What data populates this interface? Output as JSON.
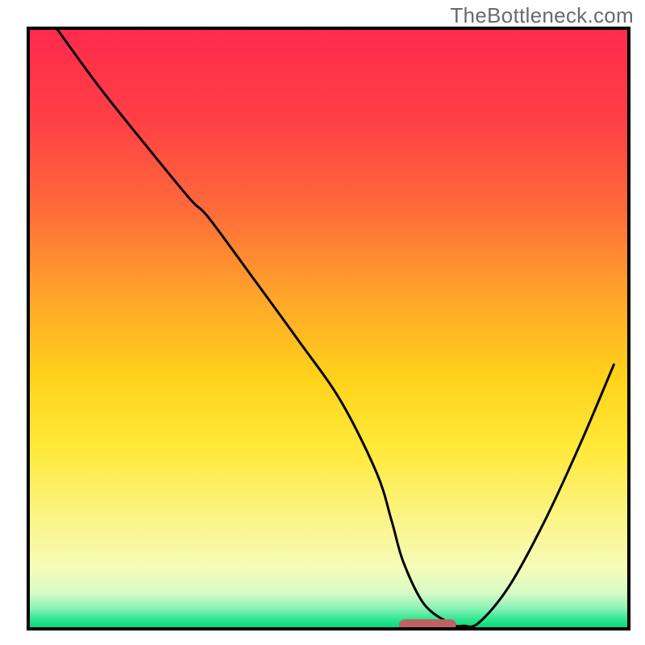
{
  "watermark": "TheBottleneck.com",
  "chart_data": {
    "type": "line",
    "title": "",
    "xlabel": "",
    "ylabel": "",
    "xlim": [
      0,
      100
    ],
    "ylim": [
      0,
      100
    ],
    "axes_visible": false,
    "grid": false,
    "background_gradient_stops": [
      {
        "offset": 0.0,
        "color": "#ff2a4d"
      },
      {
        "offset": 0.15,
        "color": "#ff3f46"
      },
      {
        "offset": 0.3,
        "color": "#ff6a3a"
      },
      {
        "offset": 0.45,
        "color": "#ffa629"
      },
      {
        "offset": 0.58,
        "color": "#ffd21a"
      },
      {
        "offset": 0.7,
        "color": "#ffe93a"
      },
      {
        "offset": 0.82,
        "color": "#fbf58a"
      },
      {
        "offset": 0.9,
        "color": "#f6fbb8"
      },
      {
        "offset": 0.94,
        "color": "#d7fbc5"
      },
      {
        "offset": 0.965,
        "color": "#8cf3b9"
      },
      {
        "offset": 0.985,
        "color": "#2be68d"
      },
      {
        "offset": 1.0,
        "color": "#06d574"
      }
    ],
    "series": [
      {
        "name": "bottleneck-curve",
        "color": "#000000",
        "x": [
          4.7,
          12,
          20,
          27,
          30,
          37,
          45,
          52,
          58,
          60.5,
          62.5,
          66,
          70.5,
          72.5,
          75,
          80,
          86,
          92,
          97.5
        ],
        "y": [
          100,
          90,
          80,
          71.5,
          68.5,
          59,
          48,
          38,
          26,
          18,
          11,
          4,
          0.8,
          0.5,
          1,
          7,
          18,
          31,
          44
        ]
      }
    ],
    "marker": {
      "name": "optimal-band",
      "shape": "rounded-rect",
      "color": "#c06065",
      "x_center": 66.5,
      "y_center": 0.7,
      "width": 9.5,
      "height": 1.8,
      "rx": 1.0
    }
  }
}
